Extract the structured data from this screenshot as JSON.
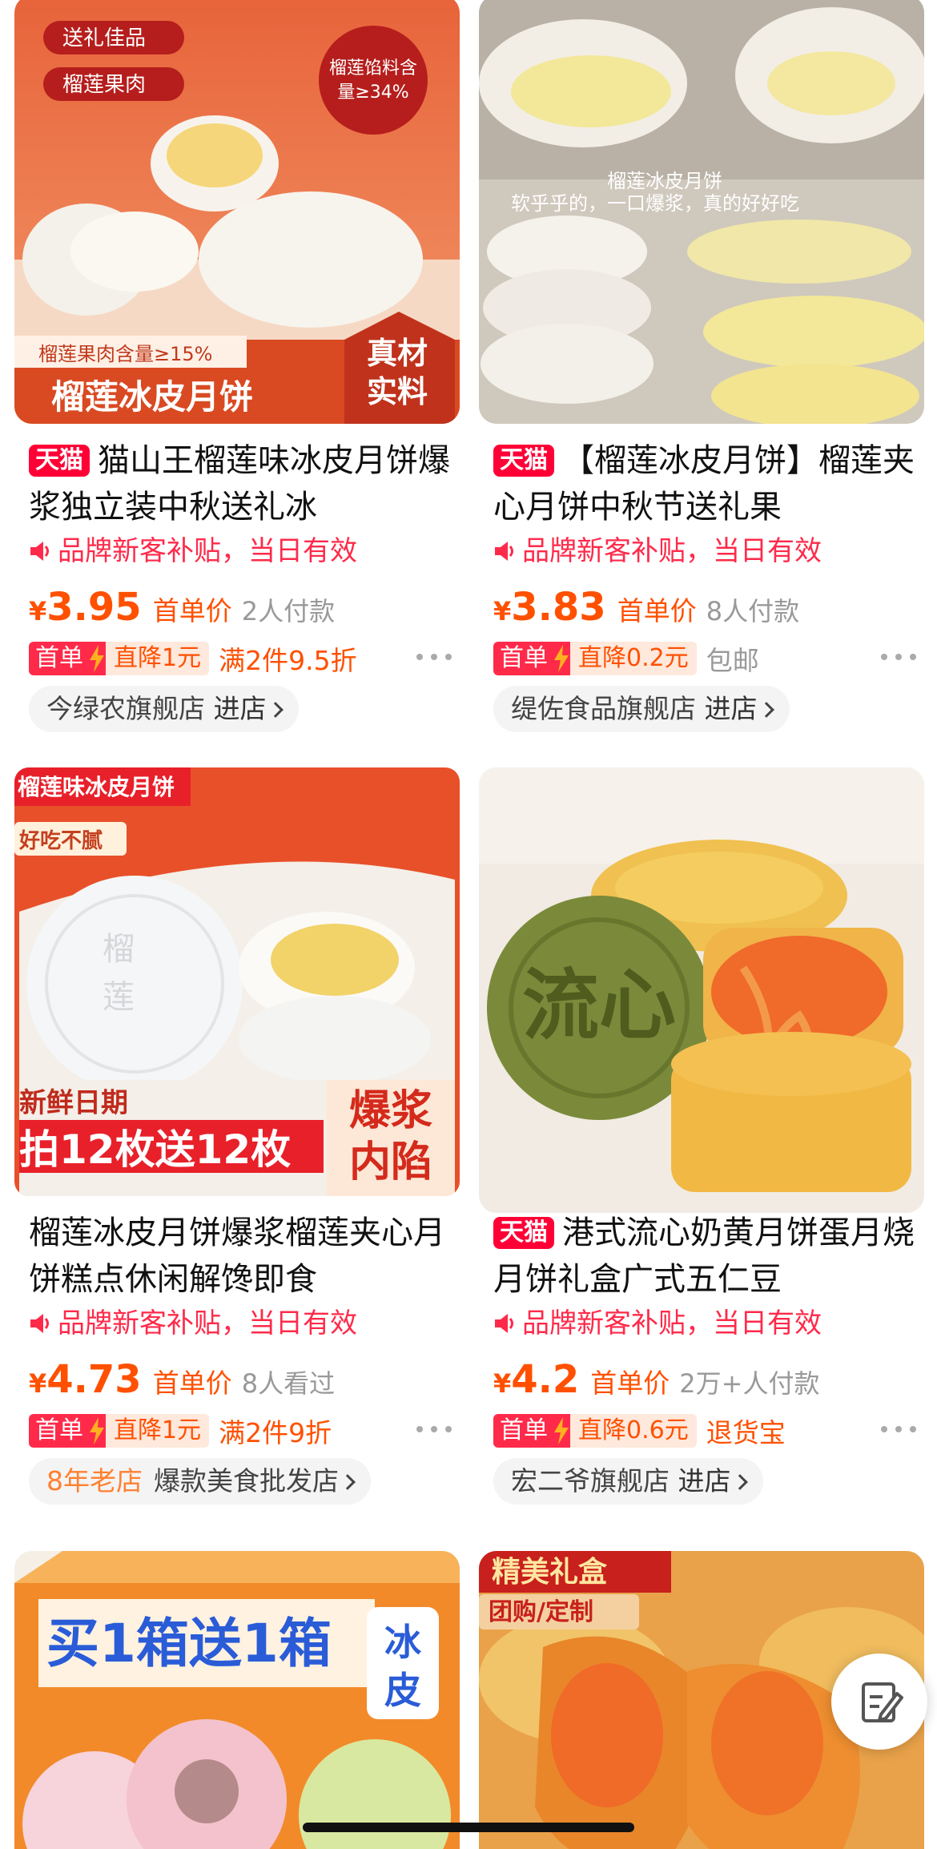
{
  "products": [
    {
      "id_label": "p1",
      "img_texts": [
        "送礼佳品",
        "榴莲果肉",
        "榴莲馅料含量≥34%",
        "榴莲果肉含量≥15%",
        "榴莲冰皮月饼",
        "真材实料"
      ],
      "tmall": "天猫",
      "title": "猫山王榴莲味冰皮月饼爆浆独立装中秋送礼冰",
      "promo": "品牌新客补贴，当日有效",
      "price": "3.95",
      "price_label": "首单价",
      "sold": "2人付款",
      "tag_first": "首单",
      "tag_off": "直降1元",
      "tag_extra": "满2件9.5折",
      "store": "今绿农旗舰店",
      "store_go": "进店"
    },
    {
      "id_label": "p2",
      "img_texts": [
        "榴莲冰皮月饼",
        "软乎乎的，一口爆浆，真的好好吃"
      ],
      "tmall": "天猫",
      "title": "【榴莲冰皮月饼】榴莲夹心月饼中秋节送礼果",
      "promo": "品牌新客补贴，当日有效",
      "price": "3.83",
      "price_label": "首单价",
      "sold": "8人付款",
      "tag_first": "首单",
      "tag_off": "直降0.2元",
      "tag_extra": "包邮",
      "store": "缇佐食品旗舰店",
      "store_go": "进店"
    },
    {
      "id_label": "p3",
      "img_texts": [
        "榴莲味冰皮月饼",
        "好吃不腻",
        "榴莲",
        "新鲜日期",
        "拍12枚送12枚",
        "爆浆内馅"
      ],
      "title": "榴莲冰皮月饼爆浆榴莲夹心月饼糕点休闲解馋即食",
      "promo": "品牌新客补贴，当日有效",
      "price": "4.73",
      "price_label": "首单价",
      "sold": "8人看过",
      "tag_first": "首单",
      "tag_off": "直降1元",
      "tag_extra": "满2件9折",
      "store_age": "8年老店",
      "store": "爆款美食批发店"
    },
    {
      "id_label": "p4",
      "img_texts": [
        "流心"
      ],
      "tmall": "天猫",
      "title": "港式流心奶黄月饼蛋月烧月饼礼盒广式五仁豆",
      "promo": "品牌新客补贴，当日有效",
      "price": "4.2",
      "price_label": "首单价",
      "sold": "2万+人付款",
      "tag_first": "首单",
      "tag_off": "直降0.6元",
      "tag_extra": "退货宝",
      "store": "宏二爷旗舰店",
      "store_go": "进店"
    },
    {
      "id_label": "p5",
      "img_texts": [
        "买1箱送1箱",
        "冰皮"
      ]
    },
    {
      "id_label": "p6",
      "img_texts": [
        "精美礼盒",
        "团购/定制"
      ]
    }
  ],
  "currency": "¥",
  "colors": {
    "accent": "#ff5000",
    "tmall": "#ff0036",
    "promo": "#ff2a4a"
  },
  "icons": {
    "fab": "edit-note-icon",
    "promo": "speaker-icon"
  }
}
